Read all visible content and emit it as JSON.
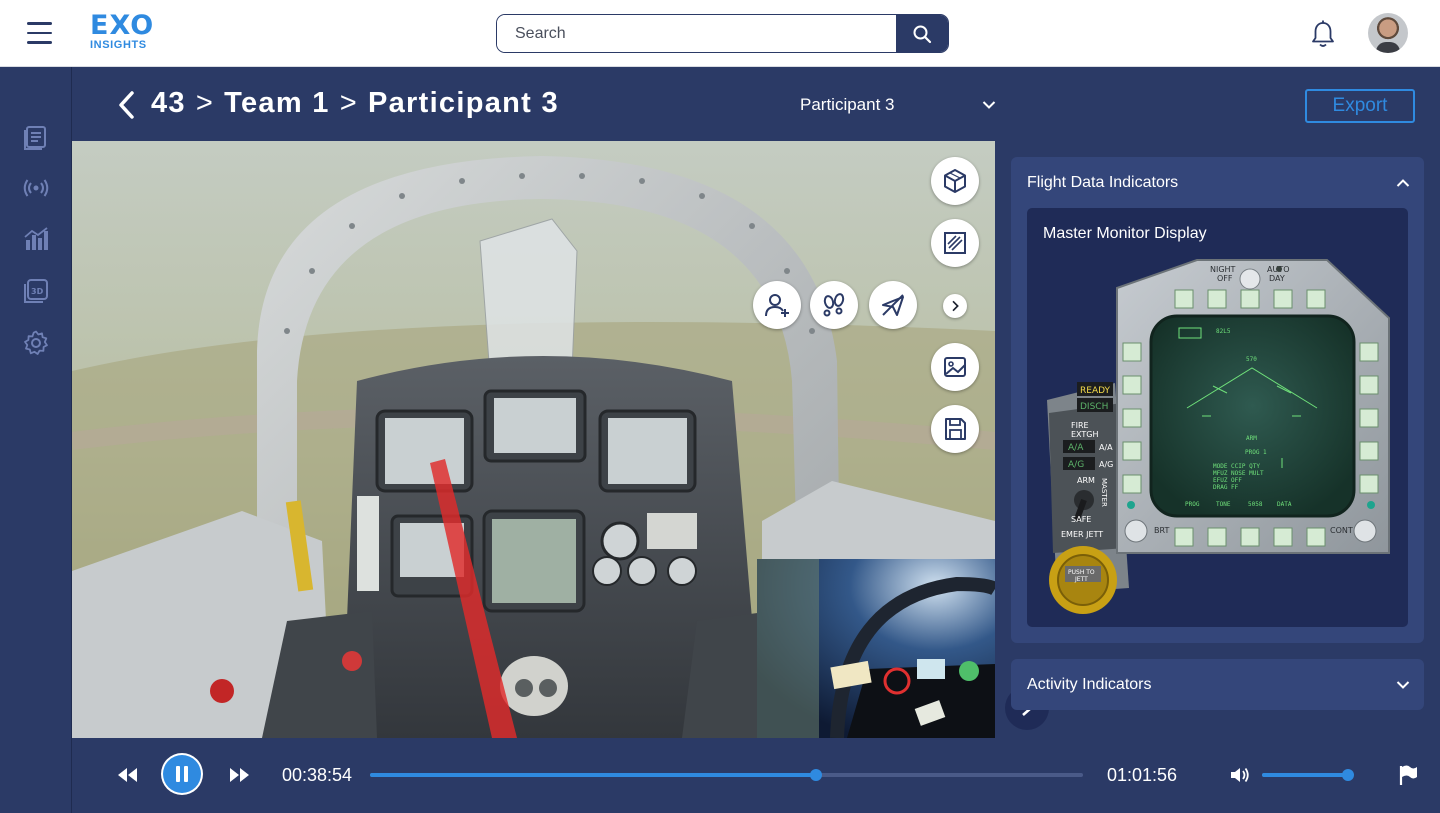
{
  "app": {
    "logo_main": "EXO",
    "logo_sub": "INSIGHTS"
  },
  "search": {
    "placeholder": "Search",
    "icon": "search-icon"
  },
  "header": {
    "notification_icon": "bell-icon",
    "avatar": "user-avatar"
  },
  "sidebar": {
    "items": [
      {
        "name": "reports",
        "icon": "document-list-icon"
      },
      {
        "name": "live",
        "icon": "broadcast-icon"
      },
      {
        "name": "analytics",
        "icon": "bar-chart-icon"
      },
      {
        "name": "3d",
        "icon": "3d-icon"
      },
      {
        "name": "settings",
        "icon": "gear-icon"
      }
    ]
  },
  "breadcrumb": {
    "items": [
      "43",
      "Team 1",
      "Participant 3"
    ],
    "separator": ">"
  },
  "participant_select": {
    "selected": "Participant 3"
  },
  "export_label": "Export",
  "viewport_tools": [
    {
      "name": "3d-view-tool",
      "icon": "cube-icon"
    },
    {
      "name": "zoom-region-tool",
      "icon": "zoom-frame-icon"
    },
    {
      "name": "add-participant-tool",
      "icon": "person-add-icon"
    },
    {
      "name": "footsteps-tool",
      "icon": "footsteps-icon"
    },
    {
      "name": "flight-path-tool",
      "icon": "plane-off-icon"
    },
    {
      "name": "more-tools",
      "icon": "chevron-right-icon"
    },
    {
      "name": "screenshot-tool",
      "icon": "image-icon"
    },
    {
      "name": "save-tool",
      "icon": "save-icon"
    }
  ],
  "right_panel": {
    "flight_data": {
      "title": "Flight Data Indicators",
      "expanded": true
    },
    "mmd": {
      "title": "Master Monitor Display",
      "labels": {
        "night_off": "NIGHT\nOFF",
        "auto_day": "AUTO\nDAY",
        "ready": "READY",
        "disch": "DISCH",
        "fire": "FIRE\nEXTGH",
        "aa": "A/A",
        "ag": "A/G",
        "arm": "ARM",
        "safe": "SAFE",
        "master": "MASTER",
        "emer_jett": "EMER JETT",
        "push_to_jett": "PUSH TO\nJETT",
        "brt": "BRT",
        "cont": "CONT",
        "screen_arm": "ARM",
        "screen_top": "570",
        "screen_prog": "PROG",
        "screen_tone": "TONE",
        "screen_5058": "5058",
        "screen_data": "DATA"
      }
    },
    "activity": {
      "title": "Activity Indicators",
      "expanded": false
    }
  },
  "playback": {
    "current_time": "00:38:54",
    "total_time": "01:01:56",
    "progress": 0.626,
    "volume": 1.0,
    "state": "playing"
  },
  "colors": {
    "brand": "#2f8ae0",
    "navy": "#2b3a66",
    "panel": "#34467a",
    "card": "#1f2b57"
  }
}
